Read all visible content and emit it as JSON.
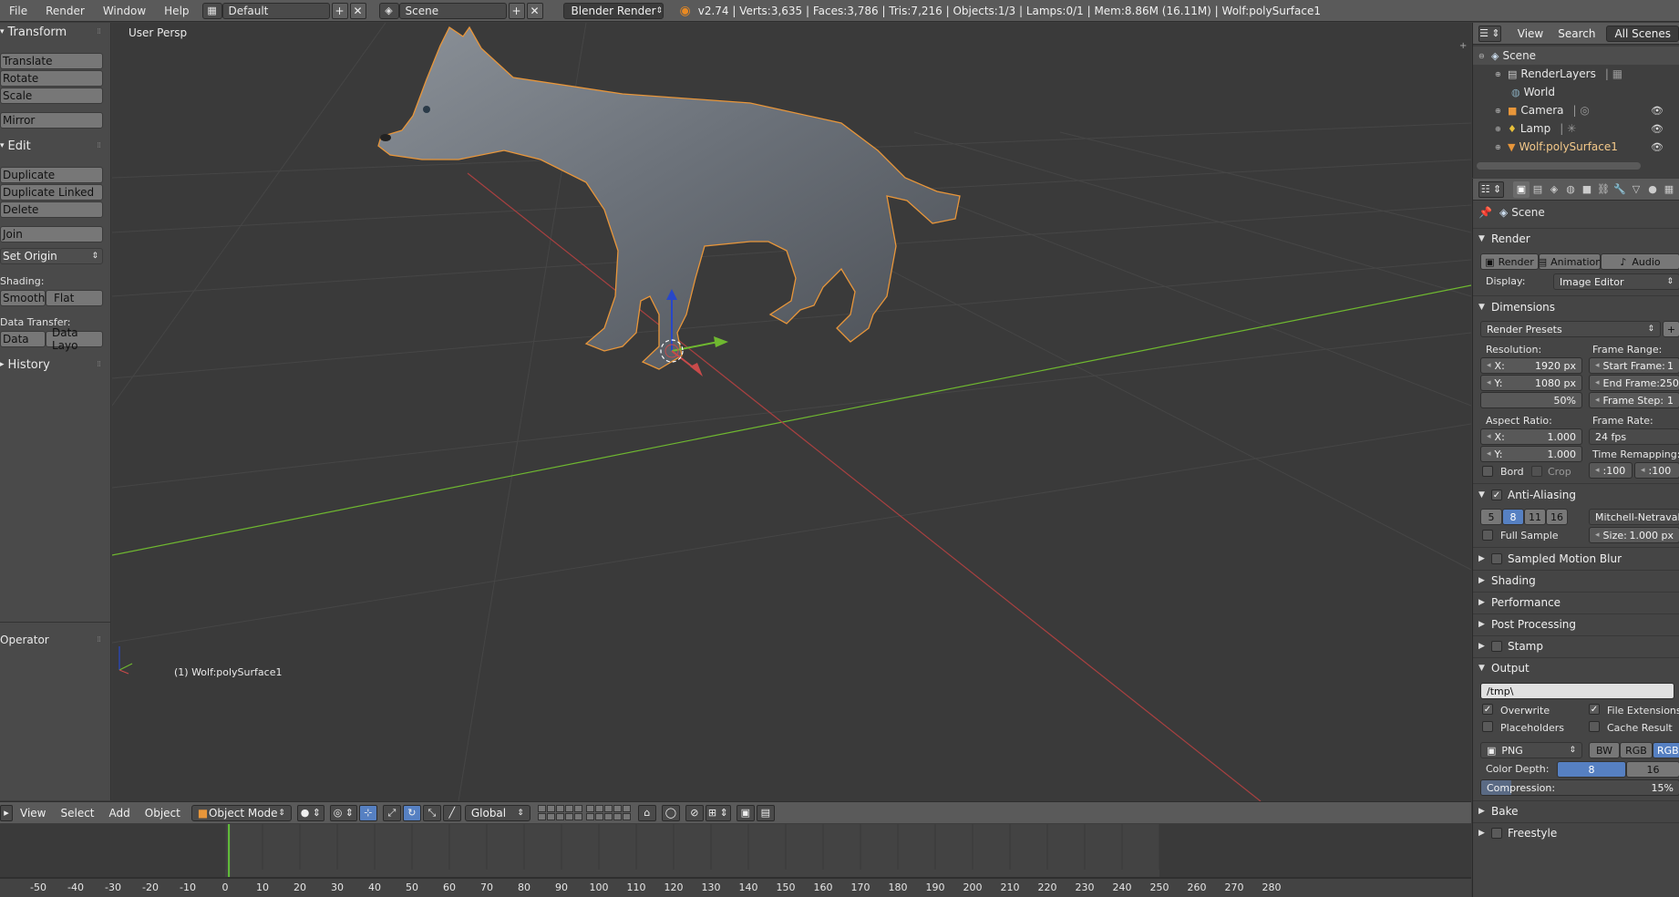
{
  "topbar": {
    "menus": [
      "File",
      "Render",
      "Window",
      "Help"
    ],
    "layout": "Default",
    "scene": "Scene",
    "engine": "Blender Render",
    "stats": "v2.74 | Verts:3,635 | Faces:3,786 | Tris:7,216 | Objects:1/3 | Lamps:0/1 | Mem:8.86M (16.11M) | Wolf:polySurface1"
  },
  "toolshelf": {
    "transform_title": "Transform",
    "translate": "Translate",
    "rotate": "Rotate",
    "scale": "Scale",
    "mirror": "Mirror",
    "edit_title": "Edit",
    "duplicate": "Duplicate",
    "duplicate_linked": "Duplicate Linked",
    "delete": "Delete",
    "join": "Join",
    "set_origin": "Set Origin",
    "shading_label": "Shading:",
    "smooth": "Smooth",
    "flat": "Flat",
    "data_transfer_label": "Data Transfer:",
    "data": "Data",
    "data_layout": "Data Layo",
    "history_title": "History",
    "operator_title": "Operator"
  },
  "viewport": {
    "persp_label": "User Persp",
    "object_label": "(1) Wolf:polySurface1"
  },
  "view3d_header": {
    "menus": [
      "View",
      "Select",
      "Add",
      "Object"
    ],
    "mode": "Object Mode",
    "orientation": "Global"
  },
  "timeline": {
    "ticks": [
      -50,
      -40,
      -30,
      -20,
      -10,
      0,
      10,
      20,
      30,
      40,
      50,
      60,
      70,
      80,
      90,
      100,
      110,
      120,
      130,
      140,
      150,
      160,
      170,
      180,
      190,
      200,
      210,
      220,
      230,
      240,
      250,
      260,
      270,
      280
    ]
  },
  "outliner": {
    "menus": [
      "View",
      "Search"
    ],
    "filter": "All Scenes",
    "items": [
      {
        "name": "Scene",
        "icon": "scene-icon"
      },
      {
        "name": "RenderLayers",
        "icon": "renderlayers-icon"
      },
      {
        "name": "World",
        "icon": "world-icon"
      },
      {
        "name": "Camera",
        "icon": "camera-icon"
      },
      {
        "name": "Lamp",
        "icon": "lamp-icon"
      },
      {
        "name": "Wolf:polySurface1",
        "icon": "mesh-icon"
      }
    ]
  },
  "properties": {
    "context": "Scene",
    "render_title": "Render",
    "render_btn": "Render",
    "animation_btn": "Animation",
    "audio_btn": "Audio",
    "display_label": "Display:",
    "display_value": "Image Editor",
    "dimensions_title": "Dimensions",
    "render_presets": "Render Presets",
    "resolution_label": "Resolution:",
    "res_x_label": "X:",
    "res_x": "1920 px",
    "res_y_label": "Y:",
    "res_y": "1080 px",
    "res_pct": "50%",
    "frame_range_label": "Frame Range:",
    "start_frame_label": "Start Frame:",
    "start_frame": "1",
    "end_frame_label": "End Frame:",
    "end_frame": "250",
    "frame_step_label": "Frame Step:",
    "frame_step": "1",
    "aspect_label": "Aspect Ratio:",
    "aspect_x_label": "X:",
    "aspect_x": "1.000",
    "aspect_y_label": "Y:",
    "aspect_y": "1.000",
    "frame_rate_label": "Frame Rate:",
    "frame_rate": "24 fps",
    "time_remap_label": "Time Remapping:",
    "remap_old": ":100",
    "remap_new": ":100",
    "border_label": "Bord",
    "crop_label": "Crop",
    "aa_title": "Anti-Aliasing",
    "aa_samples": [
      "5",
      "8",
      "11",
      "16"
    ],
    "aa_filter": "Mitchell-Netravali",
    "full_sample": "Full Sample",
    "size_label": "Size:",
    "size_value": "1.000 px",
    "collapsed": [
      "Sampled Motion Blur",
      "Shading",
      "Performance",
      "Post Processing",
      "Stamp"
    ],
    "output_title": "Output",
    "output_path": "/tmp\\",
    "overwrite": "Overwrite",
    "file_extensions": "File Extensions",
    "placeholders": "Placeholders",
    "cache_result": "Cache Result",
    "format": "PNG",
    "bw": "BW",
    "rgb": "RGB",
    "rgba": "RGBA",
    "color_depth_label": "Color Depth:",
    "depth_8": "8",
    "depth_16": "16",
    "compression_label": "Compression:",
    "compression": "15%",
    "compression_fraction": 0.15,
    "bake_title": "Bake",
    "freestyle_title": "Freestyle"
  },
  "colors": {
    "selected_outline": "#e8963a",
    "x_axis": "#c84a4a",
    "y_axis": "#6fb830",
    "accent_blue": "#5680c2",
    "current_frame": "#62c23a"
  }
}
